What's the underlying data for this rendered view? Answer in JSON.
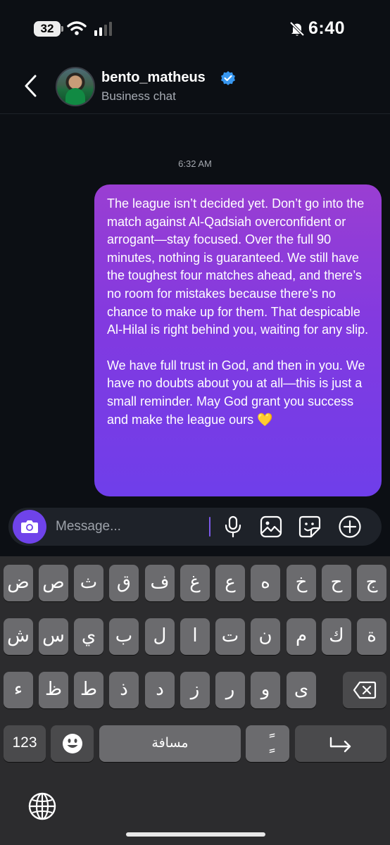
{
  "status_bar": {
    "time": "6:40",
    "battery_level": "32",
    "wifi": "wifi-icon",
    "signal": "cellular-signal-icon",
    "silent": "bell-slash-icon"
  },
  "header": {
    "back_icon": "chevron-left-icon",
    "username": "bento_matheus",
    "verified_icon": "verified-badge-icon",
    "subtitle": "Business chat"
  },
  "messages": {
    "timestamp": "6:32 AM",
    "sent": {
      "paragraph1": "The league isn’t decided yet. Don’t go into the match against Al-Qadsiah overconfident or arrogant—stay focused. Over the full 90 minutes, nothing is guaranteed. We still have the toughest four matches ahead, and there’s no room for mistakes because there’s no chance to make up for them. That despicable Al-Hilal is right behind you, waiting for any slip.",
      "paragraph2": "We have full trust in God, and then in you. We have no doubts about you at all—this is just a small reminder. May God grant you success and make the league ours 💛"
    }
  },
  "composer": {
    "placeholder": "Message...",
    "value": "",
    "icons": [
      "camera-icon",
      "microphone-icon",
      "gallery-icon",
      "sticker-icon",
      "plus-circle-icon"
    ],
    "accent": "#6f43ea"
  },
  "keyboard": {
    "row1": [
      "ض",
      "ص",
      "ث",
      "ق",
      "ف",
      "غ",
      "ع",
      "ه",
      "خ",
      "ح",
      "ج"
    ],
    "row2": [
      "ش",
      "س",
      "ي",
      "ب",
      "ل",
      "ا",
      "ت",
      "ن",
      "م",
      "ك",
      "ة"
    ],
    "row3": [
      "ء",
      "ظ",
      "ط",
      "ذ",
      "د",
      "ز",
      "ر",
      "و",
      "ى"
    ],
    "numbers_label": "123",
    "space_label": "مسافة",
    "diacritic_label": "ًٍ",
    "icons": [
      "emoji-icon",
      "backspace-icon",
      "return-icon",
      "globe-icon"
    ]
  }
}
